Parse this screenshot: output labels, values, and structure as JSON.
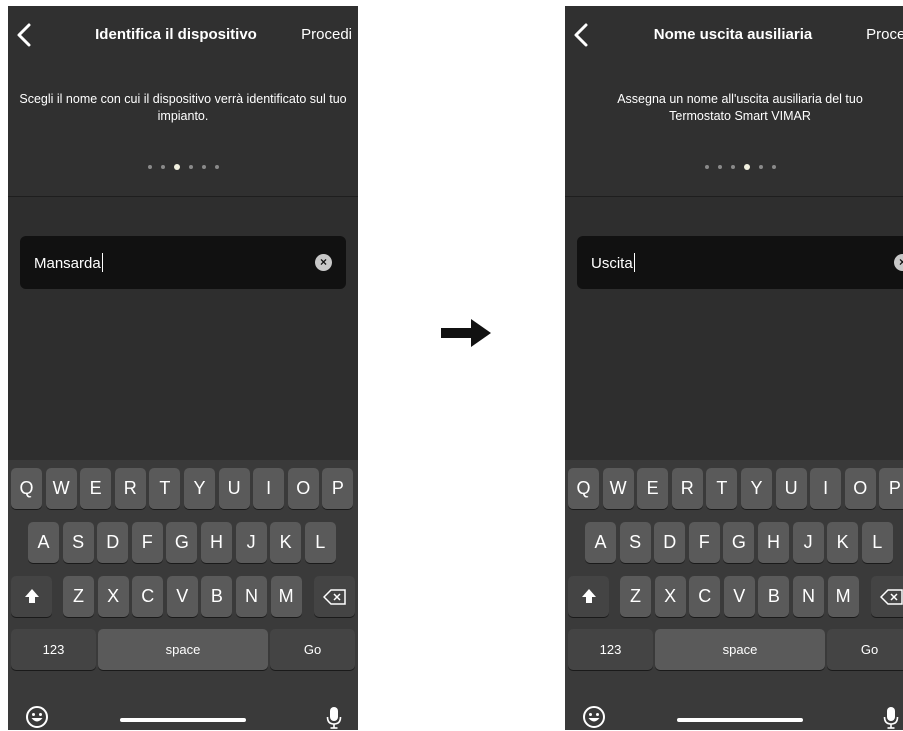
{
  "left_screen": {
    "title": "Identifica il dispositivo",
    "proceed_label": "Procedi",
    "description": "Scegli il nome con cui il dispositivo verrà identificato sul tuo impianto.",
    "step_total": 6,
    "step_current": 3,
    "input_value": "Mansarda"
  },
  "right_screen": {
    "title": "Nome uscita ausiliaria",
    "proceed_label": "Procedi",
    "description": "Assegna un nome all'uscita ausiliaria del tuo Termostato Smart VIMAR",
    "step_total": 6,
    "step_current": 4,
    "input_value": "Uscita"
  },
  "keyboard": {
    "row1": [
      "Q",
      "W",
      "E",
      "R",
      "T",
      "Y",
      "U",
      "I",
      "O",
      "P"
    ],
    "row2": [
      "A",
      "S",
      "D",
      "F",
      "G",
      "H",
      "J",
      "K",
      "L"
    ],
    "row3": [
      "Z",
      "X",
      "C",
      "V",
      "B",
      "N",
      "M"
    ],
    "numbers_label": "123",
    "space_label": "space",
    "go_label": "Go"
  },
  "icons": {
    "back": "chevron-left-icon",
    "clear": "clear-x-icon",
    "shift": "shift-icon",
    "delete": "backspace-icon",
    "emoji": "emoji-icon",
    "mic": "microphone-icon",
    "transition": "right-arrow-icon"
  },
  "colors": {
    "screen_bg": "#2e2e2e",
    "field_bg": "#111111",
    "key_bg": "#5a5a5a",
    "active_dot": "#f2f0e0"
  }
}
